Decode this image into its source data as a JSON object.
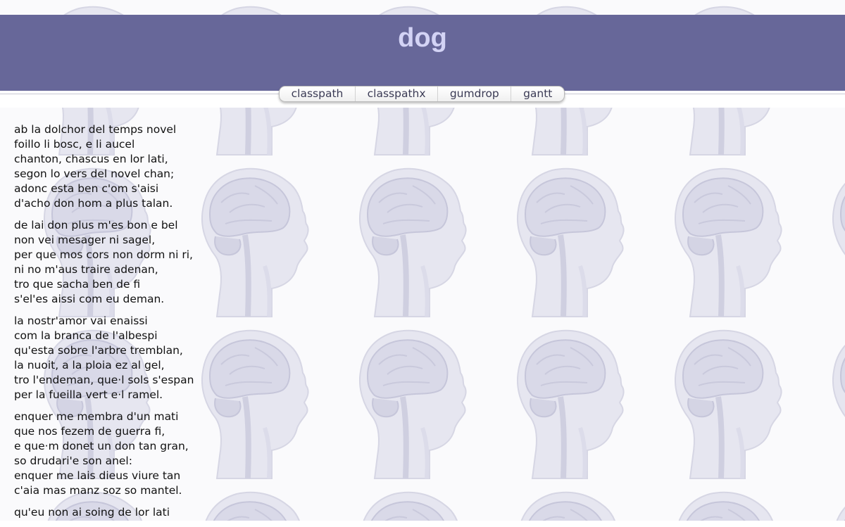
{
  "site": {
    "title": "dog"
  },
  "nav": [
    {
      "label": "classpath"
    },
    {
      "label": "classpathx"
    },
    {
      "label": "gumdrop"
    },
    {
      "label": "gantt"
    }
  ],
  "background": {
    "icon": "head-mri-watermark-icon",
    "tint": "#ebebf4"
  },
  "colors": {
    "header": "#676799",
    "title": "#d3d3f5",
    "text": "#111111"
  },
  "poem": [
    [
      "ab la dolchor del temps novel",
      "foillo li bosc, e li aucel",
      "chanton, chascus en lor lati,",
      "segon lo vers del novel chan;",
      "adonc esta ben c'om s'aisi",
      "d'acho don hom a plus talan."
    ],
    [
      "de lai don plus m'es bon e bel",
      "non vei mesager ni sagel,",
      "per que mos cors non dorm ni ri,",
      "ni no m'aus traire adenan,",
      "tro que sacha ben de fi",
      "s'el'es aissi com eu deman."
    ],
    [
      "la nostr'amor vai enaissi",
      "com la branca de l'albespi",
      "qu'esta sobre l'arbre tremblan,",
      "la nuoit, a la ploia ez al gel,",
      "tro l'endeman, que·l sols s'espan",
      "per la fueilla vert e·l ramel."
    ],
    [
      "enquer me membra d'un mati",
      "que nos fezem de guerra fi,",
      "e que·m donet un don tan gran,",
      "so drudari'e son anel:",
      "enquer me lais dieus viure tan",
      "c'aia mas manz soz so mantel."
    ],
    [
      "qu'eu non ai soing de lor lati"
    ]
  ]
}
